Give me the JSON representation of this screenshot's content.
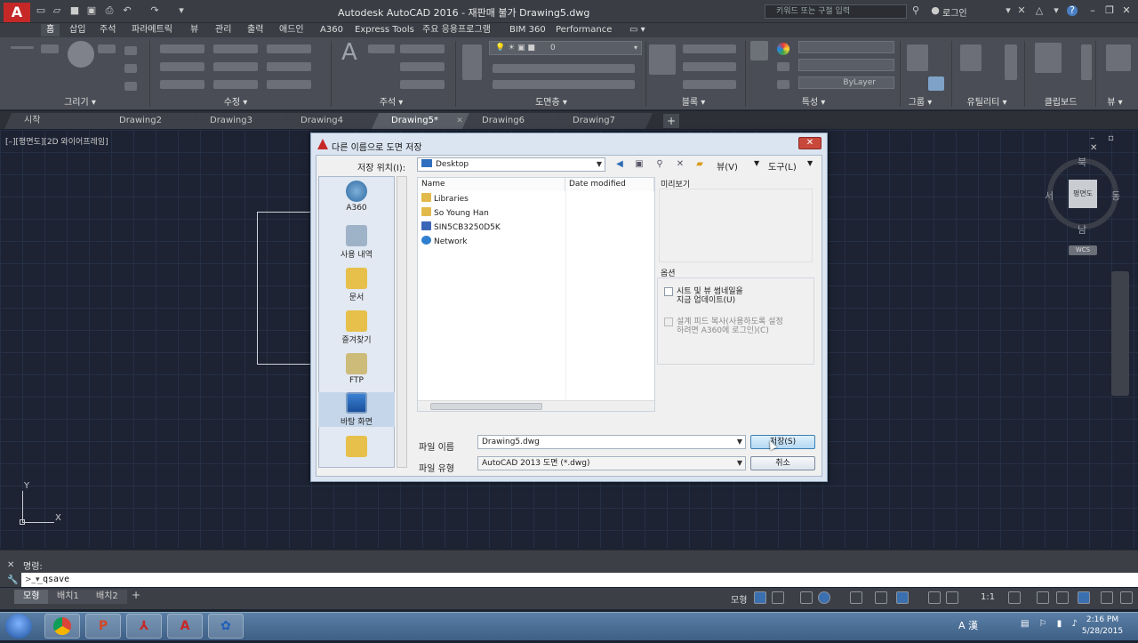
{
  "titlebar": {
    "title": "Autodesk AutoCAD 2016 - 재판매 불가   Drawing5.dwg",
    "search_placeholder": "키워드 또는 구절 입력",
    "login": "로그인"
  },
  "menu": [
    "홈",
    "삽입",
    "주석",
    "파라메트릭",
    "뷰",
    "관리",
    "출력",
    "애드인",
    "A360",
    "Express Tools",
    "주요 응용프로그램",
    "BIM 360",
    "Performance"
  ],
  "ribbon_panels": [
    "그리기 ▾",
    "수정 ▾",
    "주석 ▾",
    "도면층 ▾",
    "블록 ▾",
    "특성 ▾",
    "그룹 ▾",
    "유틸리티 ▾",
    "클립보드",
    "뷰 ▾"
  ],
  "ribbon_props": {
    "layer_value": "0",
    "bylayer": "ByLayer"
  },
  "doc_tabs": [
    "시작",
    "Drawing2",
    "Drawing3",
    "Drawing4",
    "Drawing5*",
    "Drawing6",
    "Drawing7"
  ],
  "viewport_label": "[–][평면도][2D 와이어프레임]",
  "viewcube": {
    "north": "북",
    "south": "남",
    "east": "동",
    "west": "서",
    "face": "평면도",
    "wcs": "WCS"
  },
  "ucs": {
    "x": "X",
    "y": "Y"
  },
  "command": {
    "history": "명령:",
    "input": "_qsave"
  },
  "layout_tabs": [
    "모형",
    "배치1",
    "배치2"
  ],
  "status": {
    "model": "모형",
    "scale": "1:1"
  },
  "clock": {
    "time": "2:16 PM",
    "date": "5/28/2015"
  },
  "taskbar": {
    "ime": "A 漢"
  },
  "dialog": {
    "title": "다른 이름으로 도면 저장",
    "save_in_label": "저장 위치(I):",
    "save_in_value": "Desktop",
    "views_label": "뷰(V)",
    "tools_label": "도구(L)",
    "places": [
      "A360",
      "사용 내역",
      "문서",
      "즐겨찾기",
      "FTP",
      "바탕 화면"
    ],
    "columns": [
      "Name",
      "Date modified"
    ],
    "files": [
      "Libraries",
      "So Young Han",
      "SIN5CB3250D5K",
      "Network"
    ],
    "preview_label": "미리보기",
    "options_label": "옵션",
    "option1_line1": "시트 및 뷰 썸네일을",
    "option1_line2": "지금 업데이트(U)",
    "option2_line1": "설계 피드 복사(사용하도록 설정",
    "option2_line2": "하려면 A360에 로그인)(C)",
    "filename_label": "파일 이름",
    "filename_value": "Drawing5.dwg",
    "filetype_label": "파일 유형",
    "filetype_value": "AutoCAD 2013 도면 (*.dwg)",
    "save_button": "저장(S)",
    "cancel_button": "취소"
  }
}
